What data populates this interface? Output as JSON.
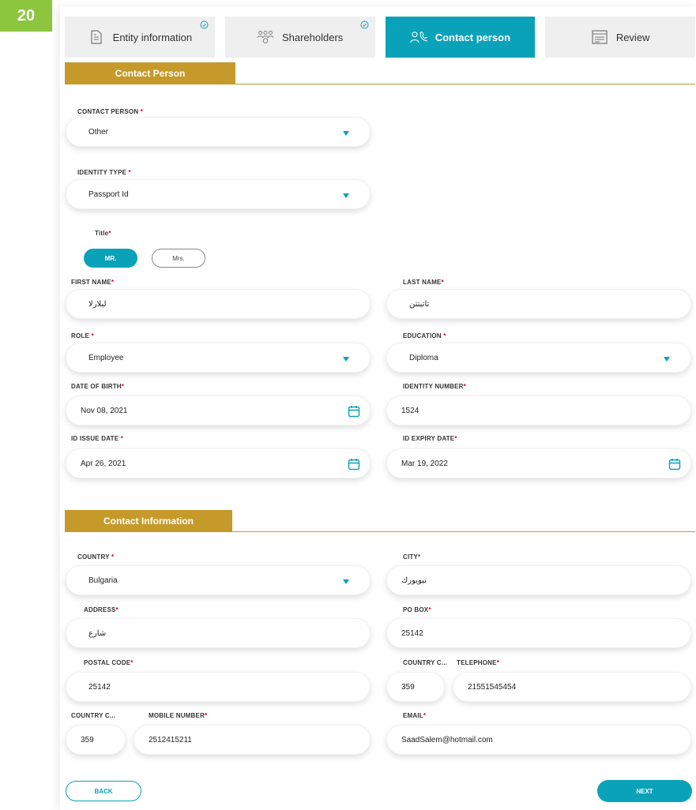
{
  "step_badge": "20",
  "tabs": [
    {
      "label": "Entity information",
      "icon": "document-icon",
      "done": true
    },
    {
      "label": "Shareholders",
      "icon": "people-group-icon",
      "done": true
    },
    {
      "label": "Contact person",
      "icon": "contact-phone-icon",
      "active": true
    },
    {
      "label": "Review",
      "icon": "review-icon"
    }
  ],
  "sections": {
    "contact_person": "Contact Person",
    "contact_information": "Contact Information"
  },
  "contact_person": {
    "label": "CONTACT PERSON",
    "value": "Other"
  },
  "identity_type": {
    "label": "IDENTITY TYPE",
    "value": "Passport Id"
  },
  "title": {
    "label": "Title",
    "options": [
      "MR.",
      "Mrs."
    ],
    "selected": "MR."
  },
  "first_name": {
    "label": "FIRST NAME",
    "value": "لبلارلا"
  },
  "last_name": {
    "label": "LAST NAME",
    "value": "تاتبتتن"
  },
  "role": {
    "label": "ROLE",
    "value": "Employee"
  },
  "education": {
    "label": "EDUCATION",
    "value": "Diploma"
  },
  "date_of_birth": {
    "label": "DATE OF BIRTH",
    "value": "Nov 08, 2021"
  },
  "identity_number": {
    "label": "IDENTITY NUMBER",
    "value": "1524"
  },
  "id_issue_date": {
    "label": "ID ISSUE DATE",
    "value": "Apr 26, 2021"
  },
  "id_expiry_date": {
    "label": "ID EXPIRY DATE",
    "value": "Mar 19, 2022"
  },
  "country": {
    "label": "COUNTRY",
    "value": "Bulgaria"
  },
  "city": {
    "label": "CITY",
    "value": "نيويورك"
  },
  "address": {
    "label": "ADDRESS",
    "value": "شارع"
  },
  "po_box": {
    "label": "PO BOX",
    "value": "25142"
  },
  "postal_code": {
    "label": "POSTAL CODE",
    "value": "25142"
  },
  "tel_country_code": {
    "label": "COUNTRY C...",
    "value": "359"
  },
  "telephone": {
    "label": "TELEPHONE",
    "value": "21551545454"
  },
  "mob_country_code": {
    "label": "COUNTRY C...",
    "value": "359"
  },
  "mobile_number": {
    "label": "MOBILE NUMBER",
    "value": "2512415211"
  },
  "email": {
    "label": "EMAIL",
    "value": "SaadSalem@hotmail.com"
  },
  "actions": {
    "back": "BACK",
    "next": "NEXT"
  },
  "required_mark": "*",
  "colors": {
    "accent": "#0aa2b8",
    "gold": "#c59a2a",
    "badge": "#8cc63f",
    "required": "#d0021b"
  }
}
